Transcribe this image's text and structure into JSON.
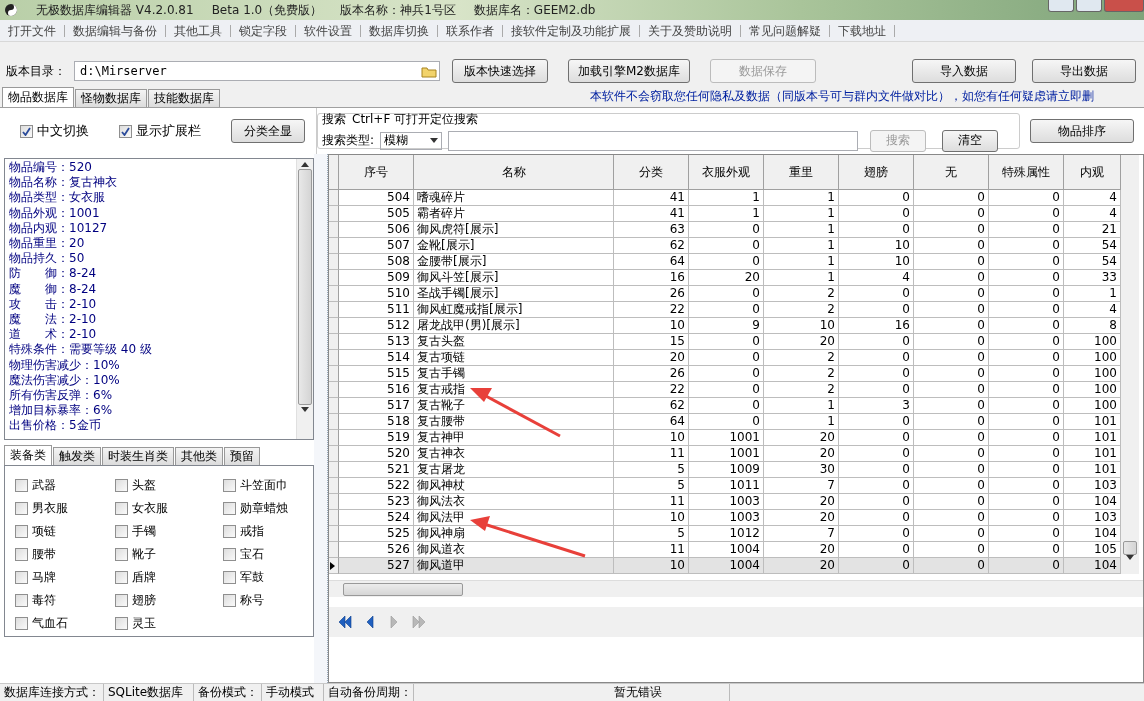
{
  "window": {
    "title": "无极数据库编辑器 V4.2.0.81",
    "edition": "Beta 1.0（免费版）",
    "version_name": "版本名称：神兵1号区",
    "database": "数据库名：GEEM2.db"
  },
  "menu": [
    "打开文件",
    "数据编辑与备份",
    "其他工具",
    "锁定字段",
    "软件设置",
    "数据库切换",
    "联系作者",
    "接软件定制及功能扩展",
    "关于及赞助说明",
    "常见问题解疑",
    "下载地址"
  ],
  "toolbar": {
    "dir_label": "版本目录：",
    "dir_value": "d:\\Mirserver",
    "buttons": [
      {
        "label": "版本快速选择",
        "disabled": false
      },
      {
        "label": "加载引擎M2数据库",
        "disabled": false
      },
      {
        "label": "数据保存",
        "disabled": true
      }
    ],
    "right_buttons": [
      "导入数据",
      "导出数据"
    ]
  },
  "db_tabs": [
    {
      "label": "物品数据库",
      "selected": true
    },
    {
      "label": "怪物数据库",
      "selected": false
    },
    {
      "label": "技能数据库",
      "selected": false
    }
  ],
  "notice": "本软件不会窃取您任何隐私及数据（同版本号可与群内文件做对比），如您有任何疑虑请立即删",
  "options": [
    {
      "label": "中文切换",
      "checked": true
    },
    {
      "label": "显示扩展栏",
      "checked": true
    }
  ],
  "show_all_button": "分类全显",
  "search": {
    "title": "搜索",
    "hint": "Ctrl+F 可打开定位搜索",
    "type_label": "搜索类型:",
    "type_value": "模糊",
    "search_button": {
      "label": "搜索",
      "disabled": true
    },
    "clear_button": "清空"
  },
  "sort_button": "物品排序",
  "item_info": [
    "物品编号：520",
    "物品名称：复古神衣",
    "物品类型：女衣服",
    "物品外观：1001",
    "物品内观：10127",
    "物品重里：20",
    "物品持久：50",
    "防　　御：8-24",
    "魔　　御：8-24",
    "攻　　击：2-10",
    "魔　　法：2-10",
    "道　　术：2-10",
    "特殊条件：需要等级 40 级",
    "物理伤害减少：10%",
    "魔法伤害减少：10%",
    "所有伤害反弹：6%",
    "增加目标暴率：6%",
    "出售价格：5金币"
  ],
  "category_tabs": [
    {
      "label": "装备类",
      "selected": true
    },
    {
      "label": "触发类",
      "selected": false
    },
    {
      "label": "时装生肖类",
      "selected": false
    },
    {
      "label": "其他类",
      "selected": false
    },
    {
      "label": "预留",
      "selected": false
    }
  ],
  "categories": [
    {
      "label": "武器",
      "checked": false
    },
    {
      "label": "头盔",
      "checked": false
    },
    {
      "label": "斗笠面巾",
      "checked": false
    },
    {
      "label": "男衣服",
      "checked": false
    },
    {
      "label": "女衣服",
      "checked": false
    },
    {
      "label": "勋章蜡烛",
      "checked": false
    },
    {
      "label": "项链",
      "checked": false
    },
    {
      "label": "手镯",
      "checked": false
    },
    {
      "label": "戒指",
      "checked": false
    },
    {
      "label": "腰带",
      "checked": false
    },
    {
      "label": "靴子",
      "checked": false
    },
    {
      "label": "宝石",
      "checked": false
    },
    {
      "label": "马牌",
      "checked": false
    },
    {
      "label": "盾牌",
      "checked": false
    },
    {
      "label": "军鼓",
      "checked": false
    },
    {
      "label": "毒符",
      "checked": false
    },
    {
      "label": "翅膀",
      "checked": false
    },
    {
      "label": "称号",
      "checked": false
    },
    {
      "label": "气血石",
      "checked": false
    },
    {
      "label": "灵玉",
      "checked": false
    }
  ],
  "table": {
    "columns": [
      "序号",
      "名称",
      "分类",
      "衣服外观",
      "重里",
      "翅膀",
      "无",
      "特殊属性",
      "内观"
    ],
    "rows": [
      {
        "cells": [
          "504",
          "嗜魂碎片",
          "41",
          "1",
          "1",
          "0",
          "0",
          "0",
          "4"
        ],
        "selected": false
      },
      {
        "cells": [
          "505",
          "霸者碎片",
          "41",
          "1",
          "1",
          "0",
          "0",
          "0",
          "4"
        ],
        "selected": false
      },
      {
        "cells": [
          "506",
          "御风虎符[展示]",
          "63",
          "0",
          "1",
          "0",
          "0",
          "0",
          "21"
        ],
        "selected": false
      },
      {
        "cells": [
          "507",
          "金靴[展示]",
          "62",
          "0",
          "1",
          "10",
          "0",
          "0",
          "54"
        ],
        "selected": false
      },
      {
        "cells": [
          "508",
          "金腰带[展示]",
          "64",
          "0",
          "1",
          "10",
          "0",
          "0",
          "54"
        ],
        "selected": false
      },
      {
        "cells": [
          "509",
          "御风斗笠[展示]",
          "16",
          "20",
          "1",
          "4",
          "0",
          "0",
          "33"
        ],
        "selected": false
      },
      {
        "cells": [
          "510",
          "圣战手镯[展示]",
          "26",
          "0",
          "2",
          "0",
          "0",
          "0",
          "1"
        ],
        "selected": false
      },
      {
        "cells": [
          "511",
          "御风虹魔戒指[展示]",
          "22",
          "0",
          "2",
          "0",
          "0",
          "0",
          "4"
        ],
        "selected": false
      },
      {
        "cells": [
          "512",
          "屠龙战甲(男)[展示]",
          "10",
          "9",
          "10",
          "16",
          "0",
          "0",
          "8"
        ],
        "selected": false
      },
      {
        "cells": [
          "513",
          "复古头盔",
          "15",
          "0",
          "20",
          "0",
          "0",
          "0",
          "100"
        ],
        "selected": false
      },
      {
        "cells": [
          "514",
          "复古项链",
          "20",
          "0",
          "2",
          "0",
          "0",
          "0",
          "100"
        ],
        "selected": false
      },
      {
        "cells": [
          "515",
          "复古手镯",
          "26",
          "0",
          "2",
          "0",
          "0",
          "0",
          "100"
        ],
        "selected": false
      },
      {
        "cells": [
          "516",
          "复古戒指",
          "22",
          "0",
          "2",
          "0",
          "0",
          "0",
          "100"
        ],
        "selected": false
      },
      {
        "cells": [
          "517",
          "复古靴子",
          "62",
          "0",
          "1",
          "3",
          "0",
          "0",
          "100"
        ],
        "selected": false
      },
      {
        "cells": [
          "518",
          "复古腰带",
          "64",
          "0",
          "1",
          "0",
          "0",
          "0",
          "101"
        ],
        "selected": false
      },
      {
        "cells": [
          "519",
          "复古神甲",
          "10",
          "1001",
          "20",
          "0",
          "0",
          "0",
          "101"
        ],
        "selected": false
      },
      {
        "cells": [
          "520",
          "复古神衣",
          "11",
          "1001",
          "20",
          "0",
          "0",
          "0",
          "101"
        ],
        "selected": false
      },
      {
        "cells": [
          "521",
          "复古屠龙",
          "5",
          "1009",
          "30",
          "0",
          "0",
          "0",
          "101"
        ],
        "selected": false
      },
      {
        "cells": [
          "522",
          "御风神杖",
          "5",
          "1011",
          "7",
          "0",
          "0",
          "0",
          "103"
        ],
        "selected": false
      },
      {
        "cells": [
          "523",
          "御风法衣",
          "11",
          "1003",
          "20",
          "0",
          "0",
          "0",
          "104"
        ],
        "selected": false
      },
      {
        "cells": [
          "524",
          "御风法甲",
          "10",
          "1003",
          "20",
          "0",
          "0",
          "0",
          "103"
        ],
        "selected": false
      },
      {
        "cells": [
          "525",
          "御风神扇",
          "5",
          "1012",
          "7",
          "0",
          "0",
          "0",
          "104"
        ],
        "selected": false
      },
      {
        "cells": [
          "526",
          "御风道衣",
          "11",
          "1004",
          "20",
          "0",
          "0",
          "0",
          "105"
        ],
        "selected": false
      },
      {
        "cells": [
          "527",
          "御风道甲",
          "10",
          "1004",
          "20",
          "0",
          "0",
          "0",
          "104"
        ],
        "selected": true
      }
    ]
  },
  "nav_buttons": [
    {
      "kind": "first",
      "disabled": false
    },
    {
      "kind": "prev",
      "disabled": false
    },
    {
      "kind": "next",
      "disabled": true
    },
    {
      "kind": "last",
      "disabled": true
    }
  ],
  "status_bar": [
    "数据库连接方式：",
    "SQLite数据库",
    "备份模式：",
    "手动模式",
    "自动备份周期：",
    "暂无错误"
  ]
}
